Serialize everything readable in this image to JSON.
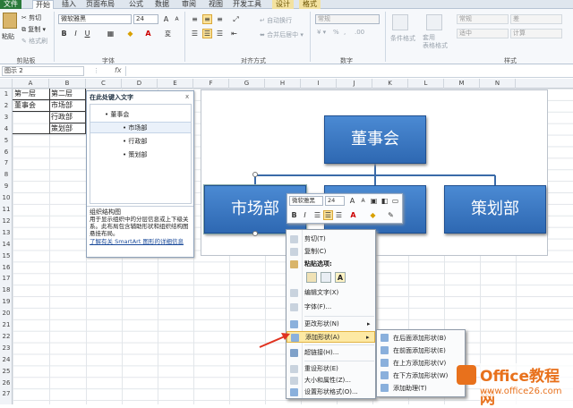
{
  "tabs": [
    "文件",
    "开始",
    "插入",
    "页面布局",
    "公式",
    "数据",
    "审阅",
    "视图",
    "开发工具",
    "设计",
    "格式"
  ],
  "ribbon": {
    "paste": "粘贴",
    "cut": "剪切",
    "copy": "复制",
    "format_painter": "格式刷",
    "font_name": "微软雅黑",
    "font_size": "24",
    "wrap": "自动换行",
    "merge": "合并后居中",
    "num_format": "常规",
    "percent": "%",
    "comma": ",",
    "cond_fmt": "条件格式",
    "table_fmt": "套用\n表格格式",
    "style_normal": "常规",
    "style_good": "适中",
    "style_bad": "差",
    "style_calc": "计算",
    "groups": [
      "剪贴板",
      "字体",
      "对齐方式",
      "数字",
      "样式"
    ]
  },
  "formula_bar": {
    "name_box": "图示 2",
    "fx": "fx"
  },
  "columns": [
    "A",
    "B",
    "C",
    "D",
    "E",
    "F",
    "G",
    "H",
    "I",
    "J",
    "K",
    "L",
    "M",
    "N"
  ],
  "rows": [
    "1",
    "2",
    "3",
    "4",
    "5",
    "6",
    "7",
    "8",
    "9",
    "10",
    "11",
    "12",
    "13",
    "14",
    "15",
    "16",
    "17",
    "18",
    "19",
    "20",
    "21",
    "22",
    "23",
    "24",
    "25",
    "26",
    "27"
  ],
  "cells": {
    "a1": "第一层",
    "b1": "第二层",
    "a2": "董事会",
    "b2": "市场部",
    "b3": "行政部",
    "b4": "策划部"
  },
  "text_pane": {
    "title": "在此处键入文字",
    "close": "x",
    "items": [
      "董事会",
      "市场部",
      "行政部",
      "策划部"
    ],
    "desc_title": "组织结构图",
    "desc": "用于显示组织中的分层信息或上下级关系。此布局包含辅助形状和组织结构图悬挂布局。",
    "link": "了解有关 SmartArt 图形的详细信息"
  },
  "smartart": {
    "top": "董事会",
    "left": "市场部",
    "right": "策划部"
  },
  "mini_toolbar": {
    "font": "微软雅黑",
    "size": "24"
  },
  "context_menu": {
    "items": [
      "剪切(T)",
      "复制(C)",
      "粘贴选项:",
      "编辑文字(X)",
      "字体(F)...",
      "更改形状(N)",
      "添加形状(A)",
      "超链接(H)...",
      "重设形状(E)",
      "大小和属性(Z)...",
      "设置形状格式(O)..."
    ]
  },
  "submenu": {
    "items": [
      "在后面添加形状(B)",
      "在前面添加形状(E)",
      "在上方添加形状(V)",
      "在下方添加形状(W)",
      "添加助理(T)"
    ]
  },
  "watermark": {
    "brand": "Office教程网",
    "url": "www.office26.com"
  },
  "colors": {
    "file_tab": "#2a7a3a",
    "shape_fill": "#3a78c4",
    "highlight": "#fde9a4",
    "arrow": "#e0321f",
    "watermark": "#e8711c"
  }
}
